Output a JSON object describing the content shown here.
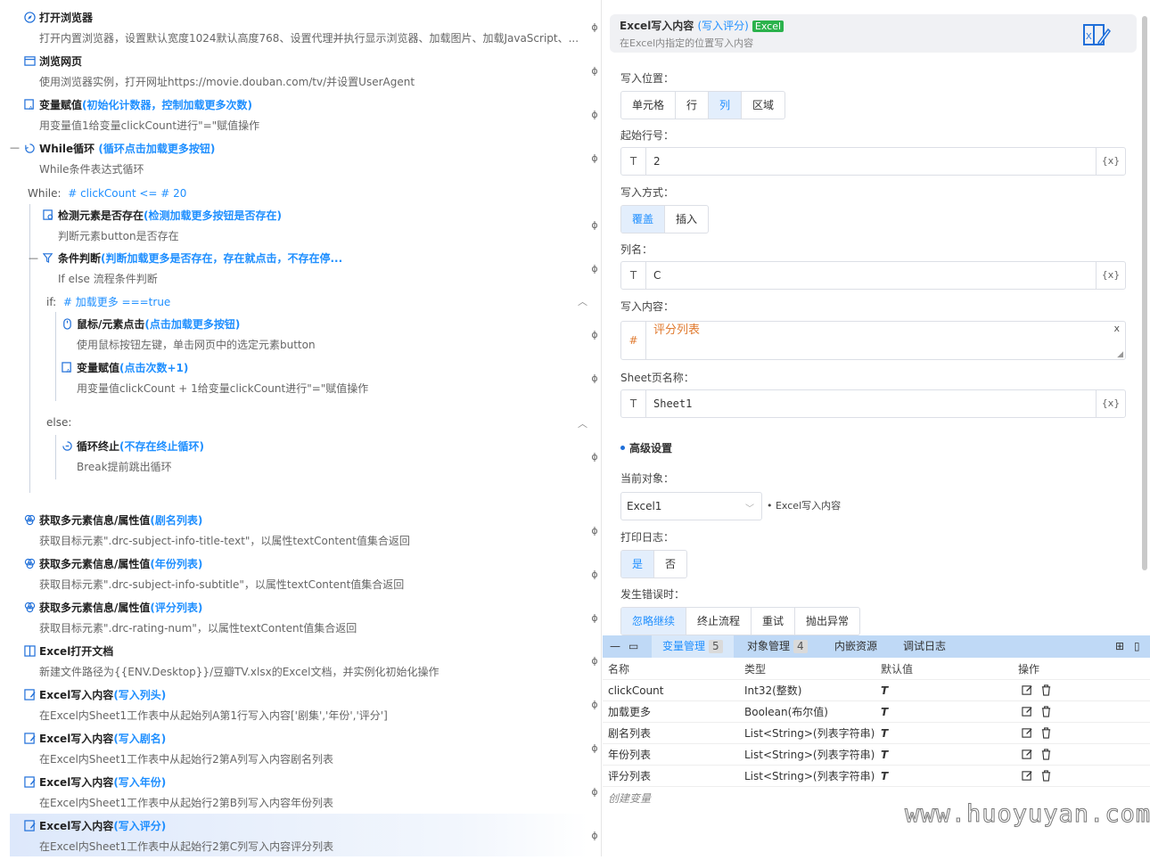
{
  "steps": [
    {
      "title": "打开浏览器",
      "sub": "",
      "desc": "打开内置浏览器，设置默认宽度1024默认高度768、设置代理并执行显示浏览器、加载图片、加载JavaScript、..."
    },
    {
      "title": "浏览网页",
      "sub": "",
      "desc": "使用浏览器实例，打开网址https://movie.douban.com/tv/并设置UserAgent"
    },
    {
      "title": "变量赋值",
      "sub": "(初始化计数器，控制加载更多次数)",
      "desc": "用变量值1给变量clickCount进行\"=\"赋值操作"
    },
    {
      "title": "While循环",
      "sub": " (循环点击加载更多按钮)",
      "desc": "While条件表达式循环"
    },
    {
      "title": "检测元素是否存在",
      "sub": "(检测加载更多按钮是否存在)",
      "desc": "判断元素button是否存在"
    },
    {
      "title": "条件判断",
      "sub": "(判断加载更多是否存在，存在就点击，不存在停...",
      "desc": "If else 流程条件判断"
    },
    {
      "title": "鼠标/元素点击",
      "sub": "(点击加载更多按钮)",
      "desc": "使用鼠标按钮左键，单击网页中的选定元素button"
    },
    {
      "title": "变量赋值",
      "sub": "(点击次数+1)",
      "desc": "用变量值clickCount + 1给变量clickCount进行\"=\"赋值操作"
    },
    {
      "title": "循环终止",
      "sub": "(不存在终止循环)",
      "desc": "Break提前跳出循环"
    },
    {
      "title": "获取多元素信息/属性值",
      "sub": "(剧名列表)",
      "desc": "获取目标元素\".drc-subject-info-title-text\"，以属性textContent值集合返回"
    },
    {
      "title": "获取多元素信息/属性值",
      "sub": "(年份列表)",
      "desc": "获取目标元素\".drc-subject-info-subtitle\"，以属性textContent值集合返回"
    },
    {
      "title": "获取多元素信息/属性值",
      "sub": "(评分列表)",
      "desc": "获取目标元素\".drc-rating-num\"，以属性textContent值集合返回"
    },
    {
      "title": "Excel打开文档",
      "sub": "",
      "desc": "新建文件路径为{{ENV.Desktop}}/豆瓣TV.xlsx的Excel文档，并实例化初始化操作"
    },
    {
      "title": "Excel写入内容",
      "sub": "(写入列头)",
      "desc": "在Excel内Sheet1工作表中从起始列A第1行写入内容['剧集','年份','评分']"
    },
    {
      "title": "Excel写入内容",
      "sub": "(写入剧名)",
      "desc": "在Excel内Sheet1工作表中从起始行2第A列写入内容剧名列表"
    },
    {
      "title": "Excel写入内容",
      "sub": "(写入年份)",
      "desc": "在Excel内Sheet1工作表中从起始行2第B列写入内容年份列表"
    },
    {
      "title": "Excel写入内容",
      "sub": "(写入评分)",
      "desc": "在Excel内Sheet1工作表中从起始行2第C列写入内容评分列表"
    }
  ],
  "while_cond": {
    "label": "While:",
    "expr": "# clickCount <= # 20"
  },
  "if_cond": {
    "label": "if:",
    "expr": "# 加载更多 ===true"
  },
  "else_label": "else:",
  "panel": {
    "title": "Excel写入内容",
    "sub": "(写入评分)",
    "badge": "Excel",
    "desc": "在Excel内指定的位置写入内容",
    "write_pos_label": "写入位置：",
    "write_pos_opts": [
      "单元格",
      "行",
      "列",
      "区域"
    ],
    "start_row_label": "起始行号：",
    "start_row_val": "2",
    "write_mode_label": "写入方式：",
    "write_mode_opts": [
      "覆盖",
      "插入"
    ],
    "col_label": "列名：",
    "col_val": "C",
    "content_label": "写入内容：",
    "content_val": "评分列表",
    "sheet_label": "Sheet页名称：",
    "sheet_val": "Sheet1",
    "type_t": "T",
    "type_hash": "#",
    "var_btn": "{x}",
    "clear_x": "x",
    "adv_label": "高级设置",
    "cur_obj_label": "当前对象：",
    "cur_obj_val": "Excel1",
    "cur_obj_hint": "• Excel写入内容",
    "log_label": "打印日志：",
    "log_opts": [
      "是",
      "否"
    ],
    "err_label": "发生错误时：",
    "err_opts": [
      "忽略继续",
      "终止流程",
      "重试",
      "抛出异常"
    ]
  },
  "bottom": {
    "tabs": [
      {
        "label": "变量管理",
        "count": "5"
      },
      {
        "label": "对象管理",
        "count": "4"
      },
      {
        "label": "内嵌资源",
        "count": ""
      },
      {
        "label": "调试日志",
        "count": ""
      }
    ],
    "headers": [
      "名称",
      "类型",
      "默认值",
      "操作"
    ],
    "rows": [
      {
        "name": "clickCount",
        "type": "Int32(整数)",
        "def": "T"
      },
      {
        "name": "加载更多",
        "type": "Boolean(布尔值)",
        "def": "T"
      },
      {
        "name": "剧名列表",
        "type": "List<String>(列表字符串)",
        "def": "T"
      },
      {
        "name": "年份列表",
        "type": "List<String>(列表字符串)",
        "def": "T"
      },
      {
        "name": "评分列表",
        "type": "List<String>(列表字符串)",
        "def": "T"
      }
    ],
    "create": "创建变量"
  },
  "watermark": "www.huoyuyan.com",
  "colors": {
    "accent": "#1f8fff",
    "excel_badge": "#2bb24c",
    "tab_bar": "#bfd9f6"
  }
}
